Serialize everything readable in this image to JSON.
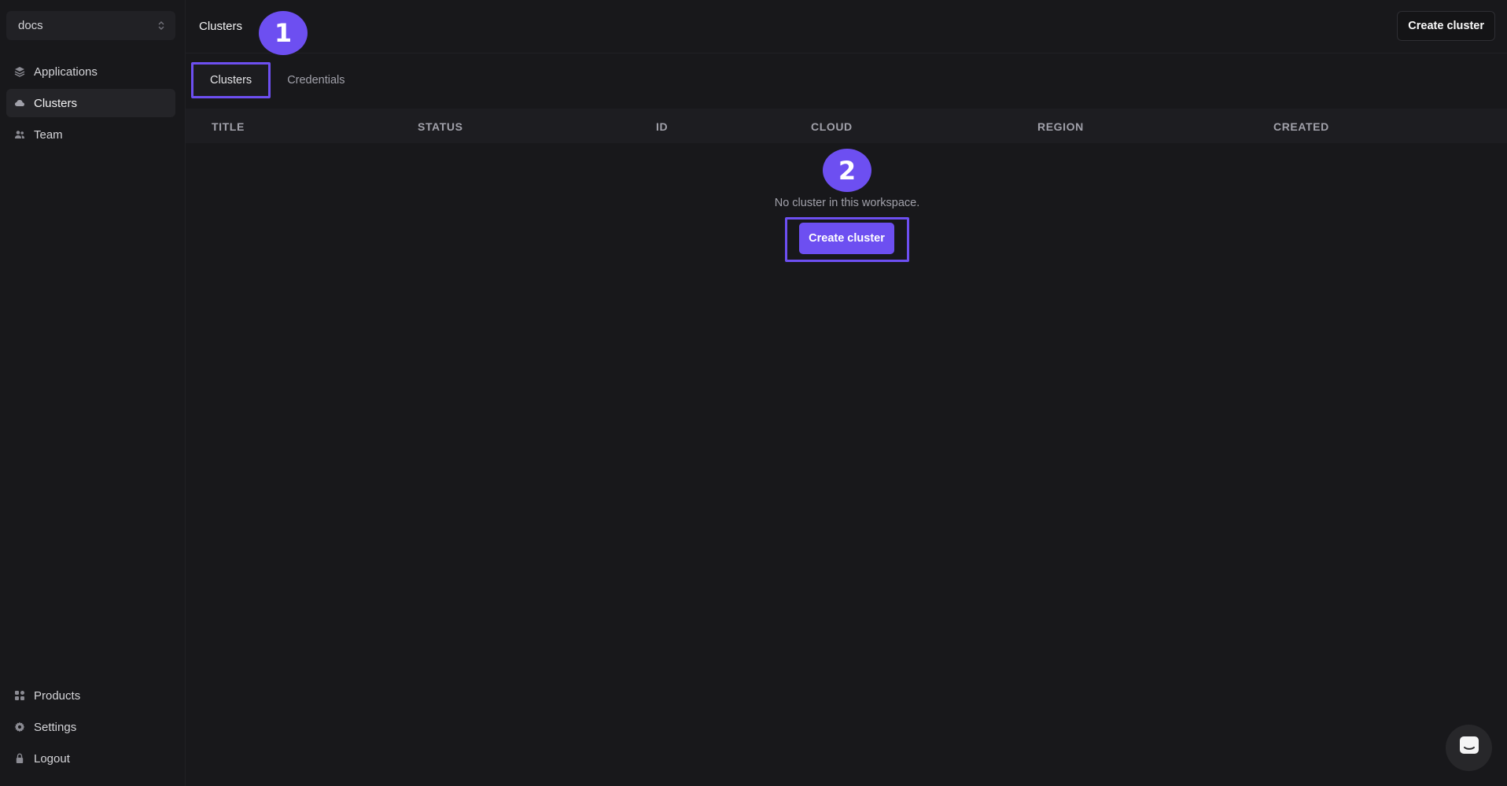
{
  "sidebar": {
    "workspace": {
      "label": "docs",
      "chevron_icon": "chevron-up-down-icon"
    },
    "items_top": [
      {
        "label": "Applications",
        "icon": "layers-icon",
        "active": false
      },
      {
        "label": "Clusters",
        "icon": "cloud-icon",
        "active": true
      },
      {
        "label": "Team",
        "icon": "users-icon",
        "active": false
      }
    ],
    "items_bottom": [
      {
        "label": "Products",
        "icon": "grid-icon"
      },
      {
        "label": "Settings",
        "icon": "gear-icon"
      },
      {
        "label": "Logout",
        "icon": "lock-icon"
      }
    ]
  },
  "header": {
    "title": "Clusters",
    "create_button": "Create cluster"
  },
  "tabs": [
    {
      "label": "Clusters",
      "active": true
    },
    {
      "label": "Credentials",
      "active": false
    }
  ],
  "table": {
    "columns": [
      "TITLE",
      "STATUS",
      "ID",
      "CLOUD",
      "REGION",
      "CREATED"
    ],
    "rows": []
  },
  "empty_state": {
    "message": "No cluster in this workspace.",
    "button": "Create cluster"
  },
  "annotations": {
    "step1": "1",
    "step2": "2",
    "color": "#6d4ff1"
  },
  "chat": {
    "icon": "chat-icon"
  },
  "colors": {
    "background": "#18181b",
    "accent": "#6d4ff1",
    "table_header": "#1d1d21"
  }
}
